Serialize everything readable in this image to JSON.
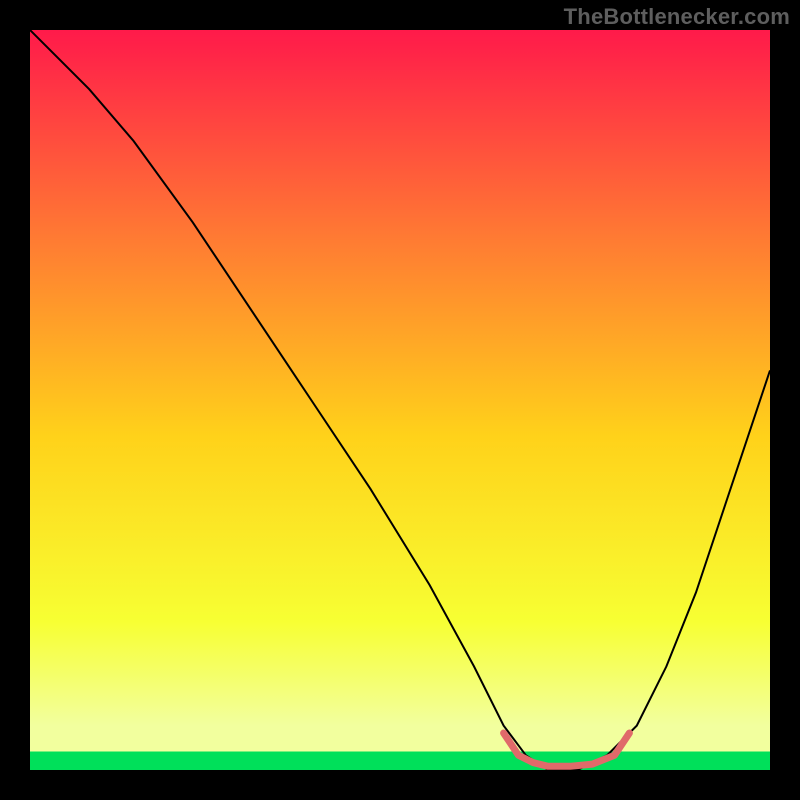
{
  "watermark": "TheBottlenecker.com",
  "chart_data": {
    "type": "line",
    "title": "",
    "xlabel": "",
    "ylabel": "",
    "xlim": [
      0,
      100
    ],
    "ylim": [
      0,
      100
    ],
    "gradient_colors": {
      "top": "#ff1a4a",
      "upper_mid": "#ff7a33",
      "mid": "#ffd21a",
      "lower_mid": "#f7ff33",
      "bottom_band": "#f2ff9e",
      "bottom_stripe": "#00e05a"
    },
    "series": [
      {
        "name": "bottleneck-curve",
        "color": "#000000",
        "x": [
          0,
          4,
          8,
          14,
          22,
          30,
          38,
          46,
          54,
          60,
          64,
          67,
          70,
          74,
          78,
          82,
          86,
          90,
          94,
          98,
          100
        ],
        "y": [
          100,
          96,
          92,
          85,
          74,
          62,
          50,
          38,
          25,
          14,
          6,
          2,
          0,
          0,
          2,
          6,
          14,
          24,
          36,
          48,
          54
        ]
      }
    ],
    "accent_segment": {
      "name": "optimal-range",
      "color": "#e06a6a",
      "x": [
        64,
        66,
        68,
        70,
        73,
        76,
        79,
        81
      ],
      "y": [
        5,
        2,
        1,
        0.5,
        0.5,
        0.8,
        2,
        5
      ]
    }
  }
}
